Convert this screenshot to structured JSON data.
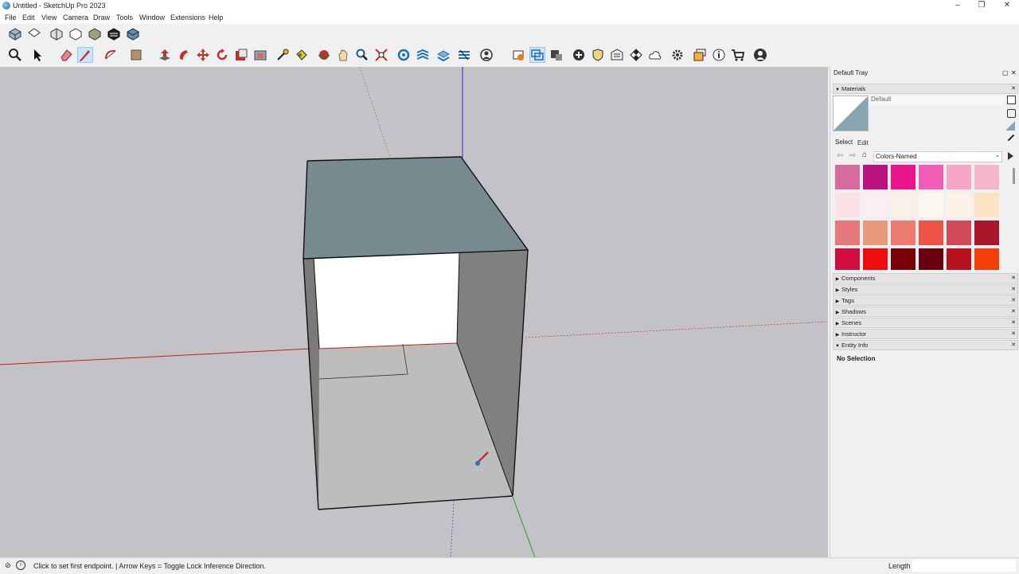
{
  "window": {
    "title": "Untitled - SketchUp Pro 2023",
    "minimize": "–",
    "maximize": "❐",
    "close": "✕"
  },
  "menu": [
    "File",
    "Edit",
    "View",
    "Camera",
    "Draw",
    "Tools",
    "Window",
    "Extensions",
    "Help"
  ],
  "tray": {
    "title": "Default Tray",
    "materials": {
      "header": "Materials",
      "current_name": "Default",
      "tab_select": "Select",
      "tab_edit": "Edit",
      "collection": "Colors-Named",
      "swatches": [
        "#d86aa0",
        "#b8127e",
        "#ea148c",
        "#f25cb6",
        "#f7a6c8",
        "#f6b6cd",
        "#fbe2e6",
        "#fbeef2",
        "#fbf0e6",
        "#fcf6ef",
        "#fdf2e8",
        "#fde2c4",
        "#e8787c",
        "#e89a7c",
        "#ee7a72",
        "#ee5446",
        "#cf4a58",
        "#a8182a",
        "#d20e40",
        "#f00c0c",
        "#7a0008",
        "#6a0010",
        "#b8121e",
        "#f33e08"
      ]
    },
    "panels": [
      "Components",
      "Styles",
      "Tags",
      "Shadows",
      "Scenes",
      "Instructor"
    ],
    "entity_info": {
      "header": "Entity Info",
      "text": "No Selection"
    }
  },
  "status": {
    "text": "Click to set first endpoint. | Arrow Keys = Toggle Lock Inference Direction.",
    "measure_label": "Length",
    "measure_value": ""
  }
}
